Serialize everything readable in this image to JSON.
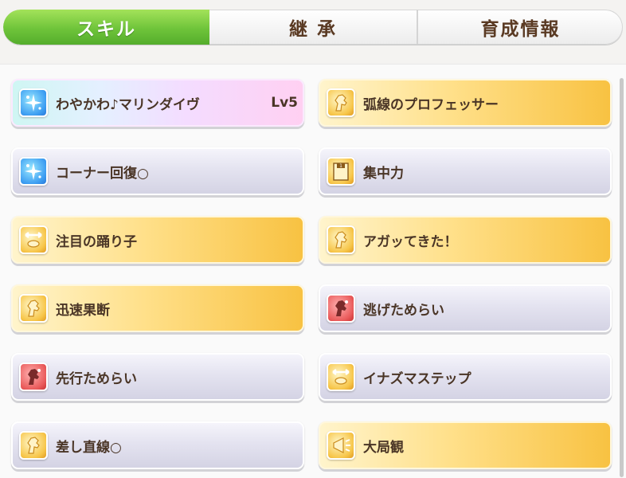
{
  "tabs": [
    {
      "label": "スキル",
      "active": true
    },
    {
      "label": "継 承",
      "active": false
    },
    {
      "label": "育成情報",
      "active": false
    }
  ],
  "skills_left": [
    {
      "name": "わやかわ♪マリンダイヴ",
      "level": "Lv5",
      "rarity": "unique",
      "icon": "sparkle-icon"
    },
    {
      "name": "コーナー回復○",
      "level": "",
      "rarity": "normal",
      "icon": "sparkle-icon"
    },
    {
      "name": "注目の踊り子",
      "level": "",
      "rarity": "gold",
      "icon": "horseshoe-icon"
    },
    {
      "name": "迅速果断",
      "level": "",
      "rarity": "gold",
      "icon": "horse-icon"
    },
    {
      "name": "先行ためらい",
      "level": "",
      "rarity": "normal",
      "icon": "debuff-horse-icon"
    },
    {
      "name": "差し直線○",
      "level": "",
      "rarity": "normal",
      "icon": "horse-icon"
    }
  ],
  "skills_right": [
    {
      "name": "弧線のプロフェッサー",
      "level": "",
      "rarity": "gold",
      "icon": "horse-icon"
    },
    {
      "name": "集中力",
      "level": "",
      "rarity": "normal",
      "icon": "gate-icon"
    },
    {
      "name": "アガッてきた！",
      "level": "",
      "rarity": "gold",
      "icon": "horse-icon"
    },
    {
      "name": "逃げためらい",
      "level": "",
      "rarity": "normal",
      "icon": "debuff-horse-icon"
    },
    {
      "name": "イナズマステップ",
      "level": "",
      "rarity": "normal",
      "icon": "horseshoe-icon"
    },
    {
      "name": "大局観",
      "level": "",
      "rarity": "gold",
      "icon": "megaphone-icon"
    }
  ],
  "colors": {
    "tab_active": "#6fc43a",
    "gold_card": "#f8c242",
    "normal_card": "#d4d3e4",
    "text": "#4a3526"
  }
}
